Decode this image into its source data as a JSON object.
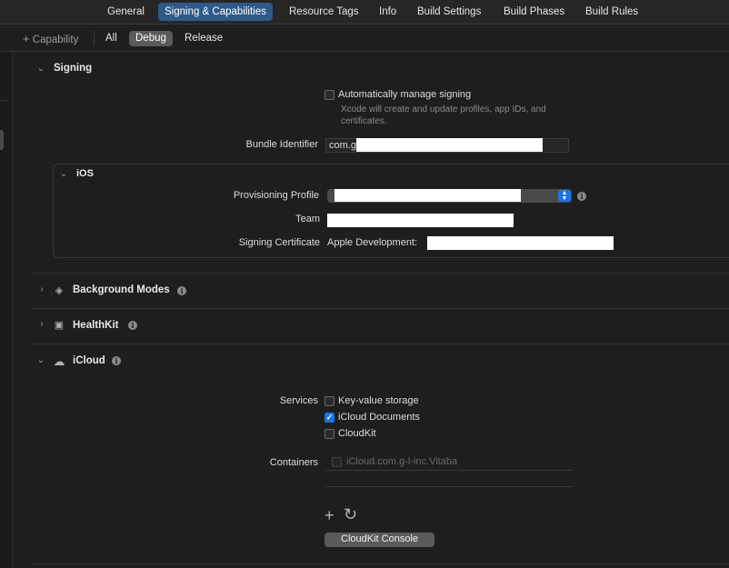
{
  "tabs": [
    {
      "label": "General"
    },
    {
      "label": "Signing & Capabilities"
    },
    {
      "label": "Resource Tags"
    },
    {
      "label": "Info"
    },
    {
      "label": "Build Settings"
    },
    {
      "label": "Build Phases"
    },
    {
      "label": "Build Rules"
    }
  ],
  "toolbar": {
    "capability_label": "Capability",
    "filters": [
      "All",
      "Debug",
      "Release"
    ],
    "selected_filter": "Debug"
  },
  "signing": {
    "title": "Signing",
    "auto_manage_label": "Automatically manage signing",
    "auto_manage_checked": false,
    "auto_manage_desc": "Xcode will create and update profiles, app IDs, and certificates.",
    "bundle_id_label": "Bundle Identifier",
    "bundle_id_value": "com.g",
    "ios": {
      "title": "iOS",
      "provisioning_label": "Provisioning Profile",
      "team_label": "Team",
      "certificate_label": "Signing Certificate",
      "certificate_value": "Apple Development:"
    }
  },
  "capabilities": [
    {
      "title": "Background Modes",
      "icon": "layers-icon"
    },
    {
      "title": "HealthKit",
      "icon": "health-icon"
    },
    {
      "title": "iCloud",
      "icon": "cloud-icon"
    }
  ],
  "icloud": {
    "services_label": "Services",
    "services": [
      {
        "label": "Key-value storage",
        "checked": false
      },
      {
        "label": "iCloud Documents",
        "checked": true
      },
      {
        "label": "CloudKit",
        "checked": false
      }
    ],
    "containers_label": "Containers",
    "container_value": "iCloud.com.g-l-inc.Vitaba",
    "console_button": "CloudKit Console"
  },
  "colors": {
    "accent": "#1a73e8",
    "selected_tab": "#2f5a87"
  }
}
